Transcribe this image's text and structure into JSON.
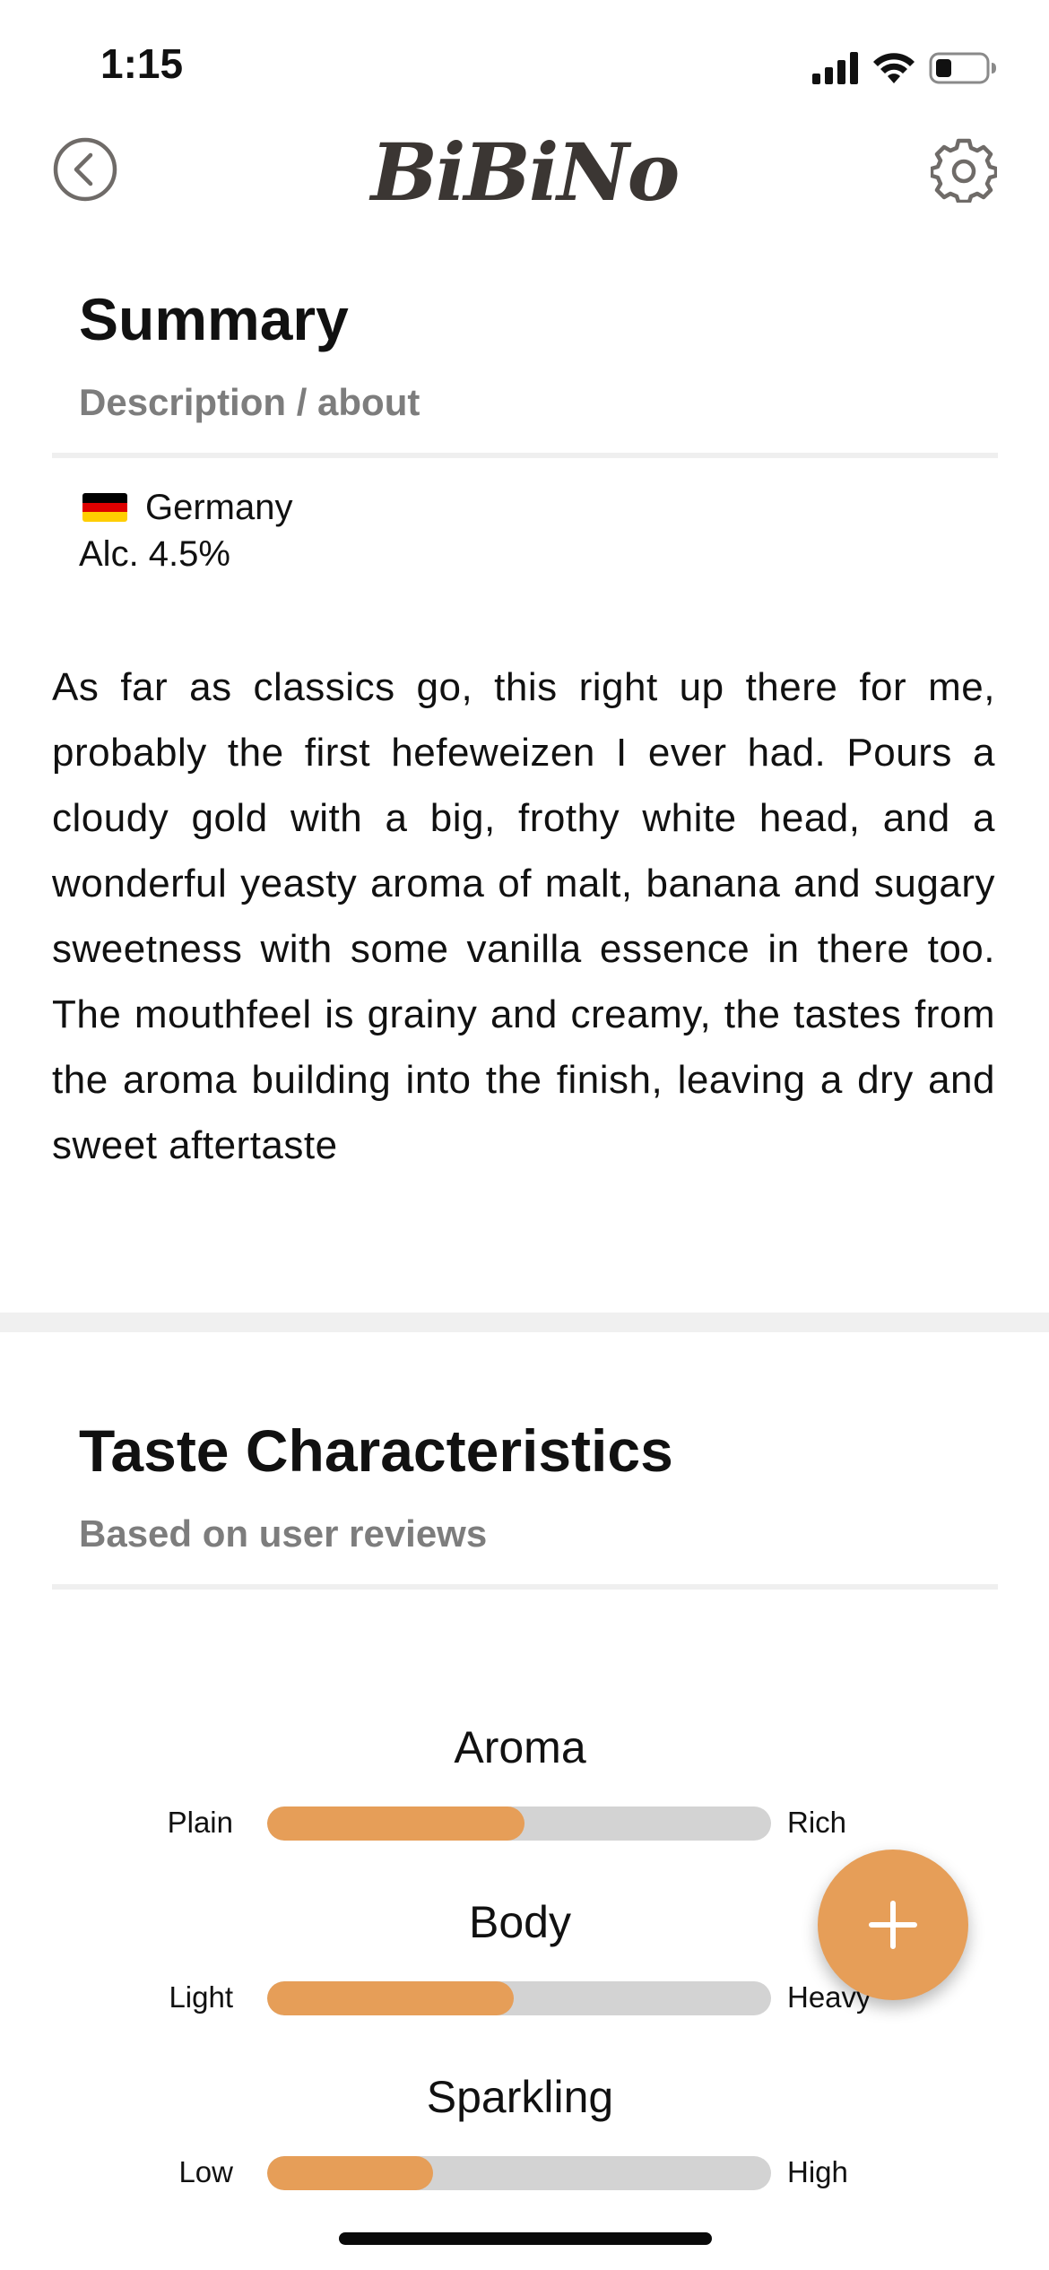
{
  "status_bar": {
    "time": "1:15",
    "icons": [
      "cellular-signal-icon",
      "wifi-icon",
      "battery-icon"
    ]
  },
  "header": {
    "logo": "BiBiNo",
    "back_icon": "chevron-left-circle-icon",
    "settings_icon": "gear-icon"
  },
  "summary": {
    "title": "Summary",
    "subtitle": "Description / about",
    "country_flag_icon": "germany-flag-icon",
    "country": "Germany",
    "alcohol": "Alc. 4.5%",
    "description": "As far as classics go, this right up there for me, probably the first hefeweizen I ever had. Pours a cloudy gold with a big, frothy white head, and a wonderful yeasty aroma of malt, banana and sugary sweetness with some vanilla essence in there too. The mouthfeel is grainy and creamy, the tastes from the aroma building into the finish, leaving a dry and sweet aftertaste"
  },
  "taste": {
    "title": "Taste Characteristics",
    "subtitle": "Based on user reviews",
    "items": [
      {
        "name": "Aroma",
        "low": "Plain",
        "high": "Rich",
        "level": 0.51
      },
      {
        "name": "Body",
        "low": "Light",
        "high": "Heavy",
        "level": 0.49
      },
      {
        "name": "Sparkling",
        "low": "Low",
        "high": "High",
        "level": 0.33
      }
    ]
  },
  "fab": {
    "icon": "plus-icon"
  },
  "colors": {
    "accent": "#e69e58",
    "track": "#d3d3d3",
    "subtitle": "#7d7d7d"
  }
}
